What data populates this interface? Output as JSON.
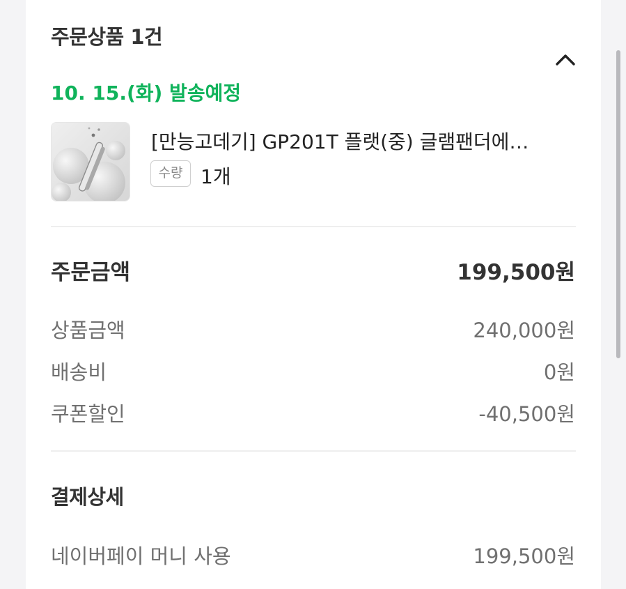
{
  "order": {
    "title": "주문상품 1건",
    "ship_date": "10. 15.(화) 발송예정",
    "product": {
      "name": "[만능고데기] GP201T 플랫(중) 글램팬더에…",
      "qty_label": "수량",
      "qty_value": "1개",
      "image_icon": "product-image"
    },
    "collapse_icon": "chevron-up-icon"
  },
  "summary": {
    "label": "주문금액",
    "total": "199,500원",
    "rows": [
      {
        "label": "상품금액",
        "value": "240,000원"
      },
      {
        "label": "배송비",
        "value": "0원"
      },
      {
        "label": "쿠폰할인",
        "value": "-40,500원"
      }
    ]
  },
  "payment": {
    "title": "결제상세",
    "rows": [
      {
        "label": "네이버페이 머니 사용",
        "value": "199,500원"
      }
    ]
  },
  "colors": {
    "accent_green": "#10b35b",
    "text_dark": "#333333",
    "text_muted": "#707070",
    "background": "#f4f4f6"
  }
}
